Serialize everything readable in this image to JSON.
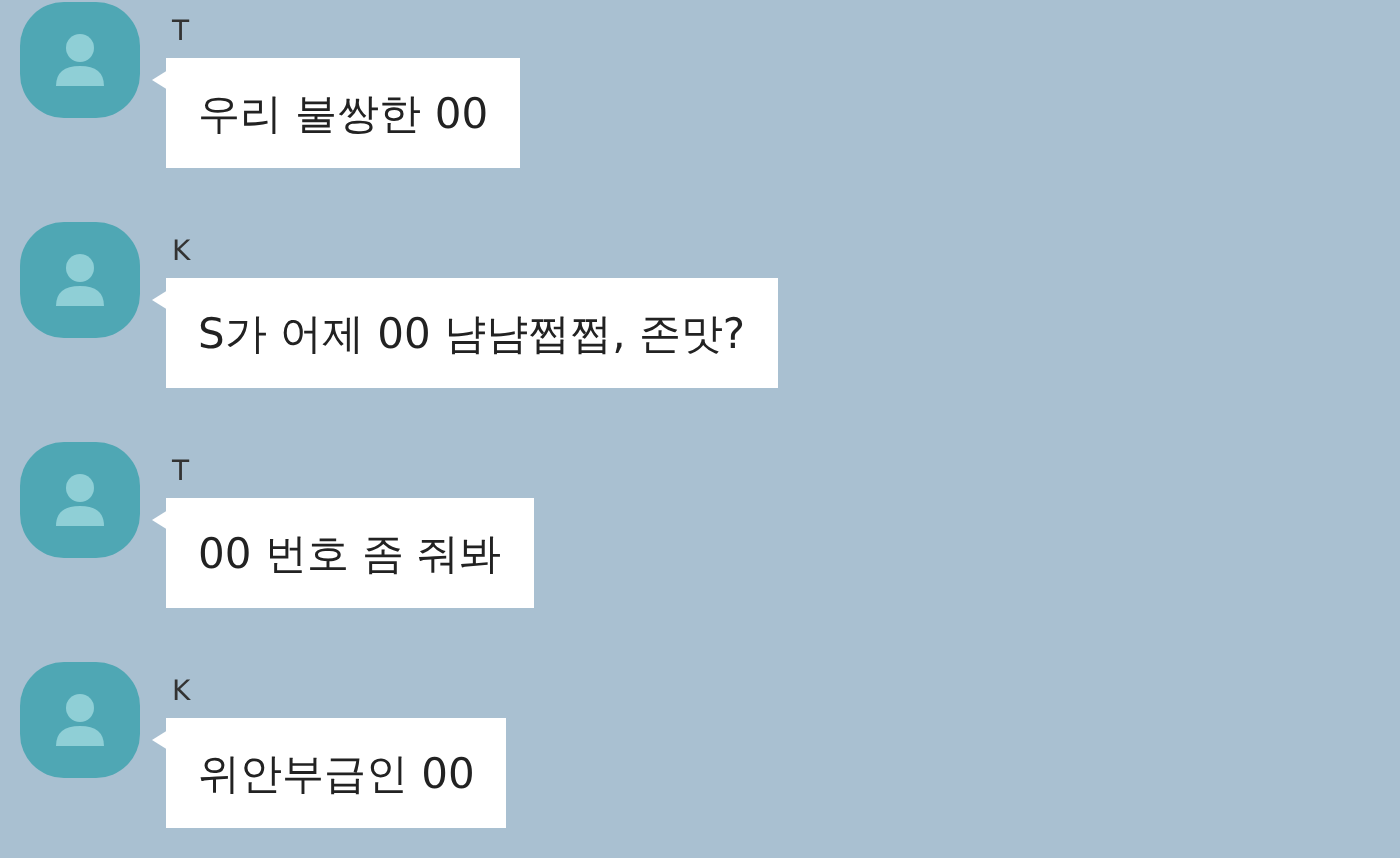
{
  "messages": [
    {
      "sender": "T",
      "text": "우리 불쌍한 00"
    },
    {
      "sender": "K",
      "text": "S가 어제 00 냠냠쩝쩝, 존맛?"
    },
    {
      "sender": "T",
      "text": "00 번호 좀 줘봐"
    },
    {
      "sender": "K",
      "text": "위안부급인 00"
    }
  ]
}
